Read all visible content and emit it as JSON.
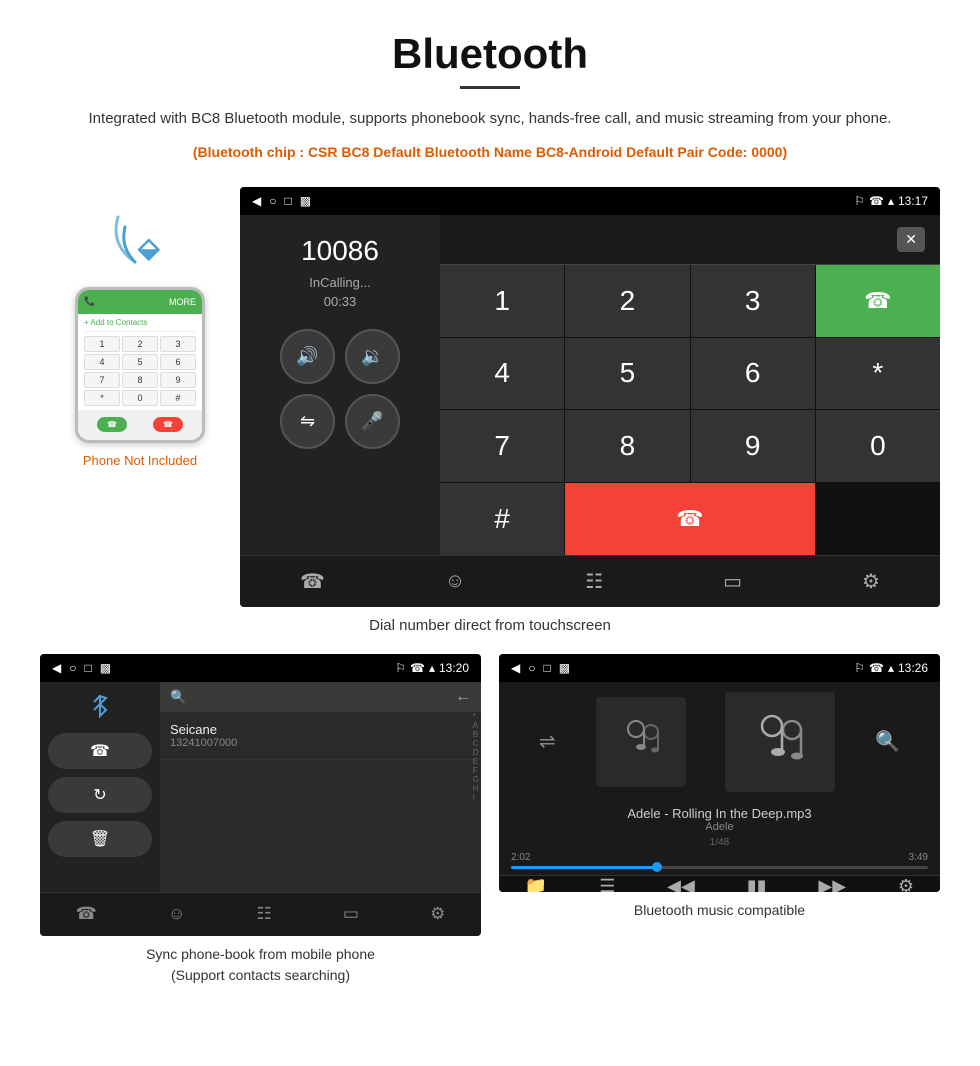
{
  "title": "Bluetooth",
  "description": "Integrated with BC8 Bluetooth module, supports phonebook sync, hands-free call, and music streaming from your phone.",
  "specs": "(Bluetooth chip : CSR BC8    Default Bluetooth Name BC8-Android    Default Pair Code: 0000)",
  "phone_not_included": "Phone Not Included",
  "dial_screen": {
    "status_time": "13:17",
    "number": "10086",
    "call_status": "InCalling...",
    "call_time": "00:33",
    "keypad": [
      "1",
      "2",
      "3",
      "*",
      "4",
      "5",
      "6",
      "0",
      "7",
      "8",
      "9",
      "#"
    ]
  },
  "dial_caption": "Dial number direct from touchscreen",
  "contacts_screen": {
    "status_time": "13:20",
    "contact_name": "Seicane",
    "contact_number": "13241007000",
    "alpha": [
      "*",
      "A",
      "B",
      "C",
      "D",
      "E",
      "F",
      "G",
      "H",
      "I"
    ]
  },
  "contacts_caption": "Sync phone-book from mobile phone\n(Support contacts searching)",
  "music_screen": {
    "status_time": "13:26",
    "song_title": "Adele - Rolling In the Deep.mp3",
    "artist": "Adele",
    "track_info": "1/48",
    "time_current": "2:02",
    "time_total": "3:49"
  },
  "music_caption": "Bluetooth music compatible"
}
